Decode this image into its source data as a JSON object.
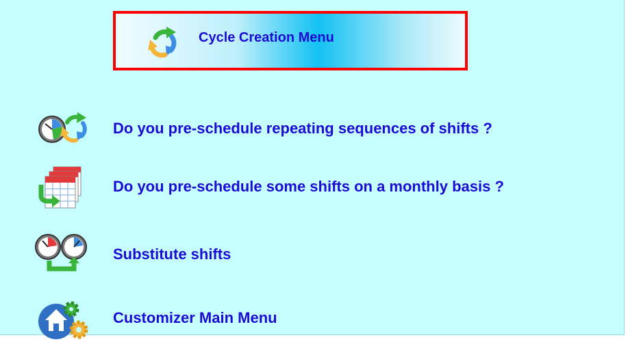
{
  "header": {
    "title": "Cycle Creation Menu",
    "icon": "recycle-arrows-icon"
  },
  "menu": {
    "items": [
      {
        "label": "Do you pre-schedule repeating sequences of shifts ?",
        "icon": "clock-cycle-icon"
      },
      {
        "label": "Do you pre-schedule some shifts on a monthly basis ?",
        "icon": "calendar-stack-icon"
      },
      {
        "label": "Substitute shifts",
        "icon": "clock-swap-icon"
      },
      {
        "label": "Customizer Main Menu",
        "icon": "home-gears-icon"
      }
    ]
  },
  "colors": {
    "background": "#c6feff",
    "label_text": "#1c0cd3",
    "title_border": "#ff0000",
    "title_gradient_center": "#13c1f3"
  }
}
